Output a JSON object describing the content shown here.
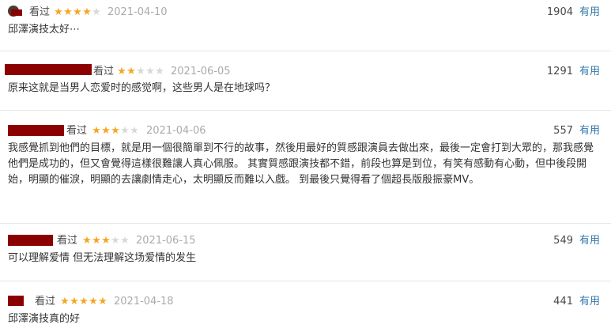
{
  "reviews": [
    {
      "look_label": "看过",
      "rating": 4,
      "date": "2021-04-10",
      "votes": "1904",
      "useful_label": "有用",
      "content": "邱澤演技太好⋯"
    },
    {
      "look_label": "看过",
      "rating": 2,
      "date": "2021-06-05",
      "votes": "1291",
      "useful_label": "有用",
      "content": "原来这就是当男人恋爱时的感觉啊，这些男人是在地球吗？"
    },
    {
      "look_label": "看过",
      "rating": 3,
      "date": "2021-04-06",
      "votes": "557",
      "useful_label": "有用",
      "content": "我感覺抓到他們的目標，就是用一個很簡單到不行的故事，然後用最好的質感跟演員去做出來，最後一定會打到大眾的，那我感覺他們是成功的，但又會覺得這樣很難讓人真心佩服。 其實質感跟演技都不錯，前段也算是到位，有笑有感動有心動，但中後段開始，明顯的催淚，明顯的去讓劇情走心，太明顯反而難以入戲。 到最後只覺得看了個超長版殷振豪MV。"
    },
    {
      "look_label": "看过",
      "rating": 3,
      "date": "2021-06-15",
      "votes": "549",
      "useful_label": "有用",
      "content": "可以理解爱情 但无法理解这场爱情的发生"
    },
    {
      "look_label": "看过",
      "rating": 5,
      "date": "2021-04-18",
      "votes": "441",
      "useful_label": "有用",
      "content": "邱澤演技真的好"
    }
  ],
  "colors": {
    "star_on": "#f5a623",
    "star_off": "#d8d8d8",
    "link": "#3377aa",
    "redaction": "#8b0000"
  }
}
